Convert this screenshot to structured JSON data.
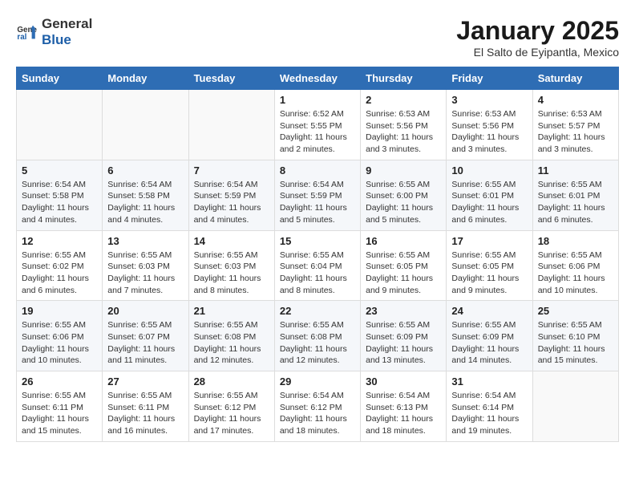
{
  "logo": {
    "text_general": "General",
    "text_blue": "Blue"
  },
  "title": "January 2025",
  "subtitle": "El Salto de Eyipantla, Mexico",
  "headers": [
    "Sunday",
    "Monday",
    "Tuesday",
    "Wednesday",
    "Thursday",
    "Friday",
    "Saturday"
  ],
  "weeks": [
    [
      {
        "day": "",
        "info": ""
      },
      {
        "day": "",
        "info": ""
      },
      {
        "day": "",
        "info": ""
      },
      {
        "day": "1",
        "info": "Sunrise: 6:52 AM\nSunset: 5:55 PM\nDaylight: 11 hours and 2 minutes."
      },
      {
        "day": "2",
        "info": "Sunrise: 6:53 AM\nSunset: 5:56 PM\nDaylight: 11 hours and 3 minutes."
      },
      {
        "day": "3",
        "info": "Sunrise: 6:53 AM\nSunset: 5:56 PM\nDaylight: 11 hours and 3 minutes."
      },
      {
        "day": "4",
        "info": "Sunrise: 6:53 AM\nSunset: 5:57 PM\nDaylight: 11 hours and 3 minutes."
      }
    ],
    [
      {
        "day": "5",
        "info": "Sunrise: 6:54 AM\nSunset: 5:58 PM\nDaylight: 11 hours and 4 minutes."
      },
      {
        "day": "6",
        "info": "Sunrise: 6:54 AM\nSunset: 5:58 PM\nDaylight: 11 hours and 4 minutes."
      },
      {
        "day": "7",
        "info": "Sunrise: 6:54 AM\nSunset: 5:59 PM\nDaylight: 11 hours and 4 minutes."
      },
      {
        "day": "8",
        "info": "Sunrise: 6:54 AM\nSunset: 5:59 PM\nDaylight: 11 hours and 5 minutes."
      },
      {
        "day": "9",
        "info": "Sunrise: 6:55 AM\nSunset: 6:00 PM\nDaylight: 11 hours and 5 minutes."
      },
      {
        "day": "10",
        "info": "Sunrise: 6:55 AM\nSunset: 6:01 PM\nDaylight: 11 hours and 6 minutes."
      },
      {
        "day": "11",
        "info": "Sunrise: 6:55 AM\nSunset: 6:01 PM\nDaylight: 11 hours and 6 minutes."
      }
    ],
    [
      {
        "day": "12",
        "info": "Sunrise: 6:55 AM\nSunset: 6:02 PM\nDaylight: 11 hours and 6 minutes."
      },
      {
        "day": "13",
        "info": "Sunrise: 6:55 AM\nSunset: 6:03 PM\nDaylight: 11 hours and 7 minutes."
      },
      {
        "day": "14",
        "info": "Sunrise: 6:55 AM\nSunset: 6:03 PM\nDaylight: 11 hours and 8 minutes."
      },
      {
        "day": "15",
        "info": "Sunrise: 6:55 AM\nSunset: 6:04 PM\nDaylight: 11 hours and 8 minutes."
      },
      {
        "day": "16",
        "info": "Sunrise: 6:55 AM\nSunset: 6:05 PM\nDaylight: 11 hours and 9 minutes."
      },
      {
        "day": "17",
        "info": "Sunrise: 6:55 AM\nSunset: 6:05 PM\nDaylight: 11 hours and 9 minutes."
      },
      {
        "day": "18",
        "info": "Sunrise: 6:55 AM\nSunset: 6:06 PM\nDaylight: 11 hours and 10 minutes."
      }
    ],
    [
      {
        "day": "19",
        "info": "Sunrise: 6:55 AM\nSunset: 6:06 PM\nDaylight: 11 hours and 10 minutes."
      },
      {
        "day": "20",
        "info": "Sunrise: 6:55 AM\nSunset: 6:07 PM\nDaylight: 11 hours and 11 minutes."
      },
      {
        "day": "21",
        "info": "Sunrise: 6:55 AM\nSunset: 6:08 PM\nDaylight: 11 hours and 12 minutes."
      },
      {
        "day": "22",
        "info": "Sunrise: 6:55 AM\nSunset: 6:08 PM\nDaylight: 11 hours and 12 minutes."
      },
      {
        "day": "23",
        "info": "Sunrise: 6:55 AM\nSunset: 6:09 PM\nDaylight: 11 hours and 13 minutes."
      },
      {
        "day": "24",
        "info": "Sunrise: 6:55 AM\nSunset: 6:09 PM\nDaylight: 11 hours and 14 minutes."
      },
      {
        "day": "25",
        "info": "Sunrise: 6:55 AM\nSunset: 6:10 PM\nDaylight: 11 hours and 15 minutes."
      }
    ],
    [
      {
        "day": "26",
        "info": "Sunrise: 6:55 AM\nSunset: 6:11 PM\nDaylight: 11 hours and 15 minutes."
      },
      {
        "day": "27",
        "info": "Sunrise: 6:55 AM\nSunset: 6:11 PM\nDaylight: 11 hours and 16 minutes."
      },
      {
        "day": "28",
        "info": "Sunrise: 6:55 AM\nSunset: 6:12 PM\nDaylight: 11 hours and 17 minutes."
      },
      {
        "day": "29",
        "info": "Sunrise: 6:54 AM\nSunset: 6:12 PM\nDaylight: 11 hours and 18 minutes."
      },
      {
        "day": "30",
        "info": "Sunrise: 6:54 AM\nSunset: 6:13 PM\nDaylight: 11 hours and 18 minutes."
      },
      {
        "day": "31",
        "info": "Sunrise: 6:54 AM\nSunset: 6:14 PM\nDaylight: 11 hours and 19 minutes."
      },
      {
        "day": "",
        "info": ""
      }
    ]
  ]
}
